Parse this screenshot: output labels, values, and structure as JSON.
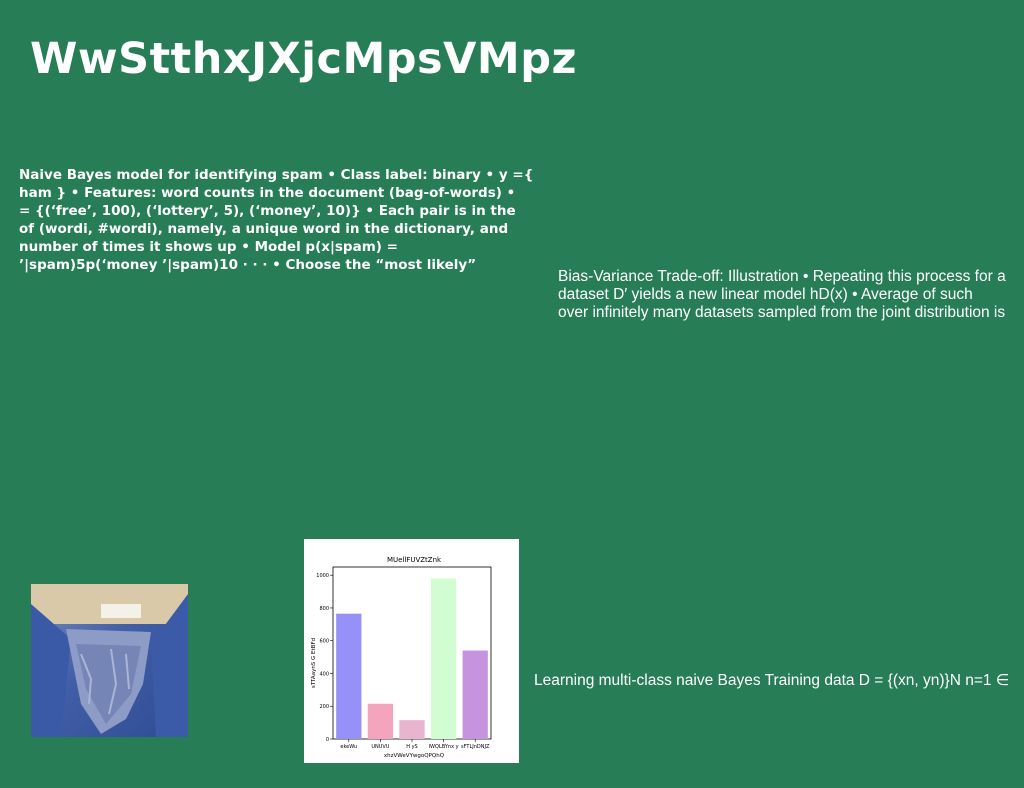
{
  "slide": {
    "title": "WwStthxJXjcMpsVMpz",
    "left_text": "Naive Bayes model for identifying spam • Class label: binary • y ={\nham } • Features: word counts in the document (bag-of-words) •\n= {(‘free’, 100), (‘lottery’, 5), (‘money’, 10)} • Each pair is in the\nof (wordi, #wordi), namely, a unique word in the dictionary, and\nnumber of times it shows up • Model p(x|spam) =\n’|spam)5p(‘money ’|spam)10 · · · • Choose the “most likely”",
    "right_text": "Bias-Variance Trade-off: Illustration • Repeating this process for a\ndataset D′ yields a new linear model hD(x) • Average of such\nover infinitely many datasets sampled from the joint distribution is",
    "bottom_text": "Learning multi-class naive Bayes Training data D = {(xn, yn)}N n=1 ∈"
  },
  "photo": {
    "icon": "torn-blue-fabric-photo"
  },
  "chart_data": {
    "type": "bar",
    "title": "MUellFUVZtZnk",
    "xlabel": "xhzVWeVYwgoQPQhQ",
    "ylabel": "sTTAaynS G EtBFd",
    "categories": [
      "ekeWu",
      "UNUVU",
      "H yS",
      "IWQLBYnx y",
      "sFTLJnDNJZ"
    ],
    "values": [
      765,
      215,
      115,
      980,
      540
    ],
    "colors": [
      "#9591f8",
      "#f5a4bd",
      "#e8b4d0",
      "#d2fdd2",
      "#c693de"
    ],
    "ylim": [
      0,
      1050
    ],
    "yticks": [
      0,
      200,
      400,
      600,
      800,
      1000
    ],
    "grid": false
  }
}
